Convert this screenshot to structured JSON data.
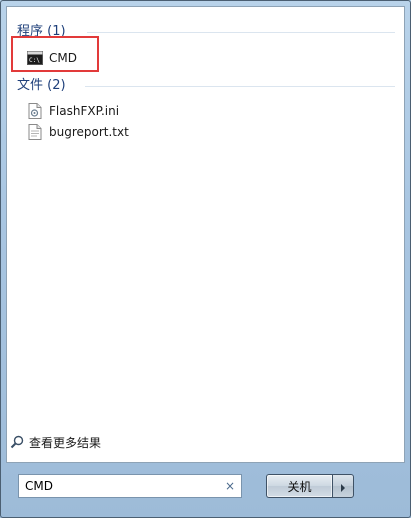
{
  "groups": {
    "programs": {
      "header": "程序 (1)",
      "items": [
        {
          "label": "CMD",
          "icon": "cmd-console-icon"
        }
      ]
    },
    "files": {
      "header": "文件 (2)",
      "items": [
        {
          "label": "FlashFXP.ini",
          "icon": "ini-settings-file-icon"
        },
        {
          "label": "bugreport.txt",
          "icon": "text-file-icon"
        }
      ]
    }
  },
  "see_more": {
    "label": "查看更多结果",
    "icon": "magnifier-icon"
  },
  "search": {
    "value": "CMD",
    "clear_glyph": "×"
  },
  "shutdown": {
    "label": "关机"
  },
  "colors": {
    "header_text": "#1e3f7a",
    "highlight_border": "#e23a3a",
    "panel_background": "#ffffff"
  }
}
